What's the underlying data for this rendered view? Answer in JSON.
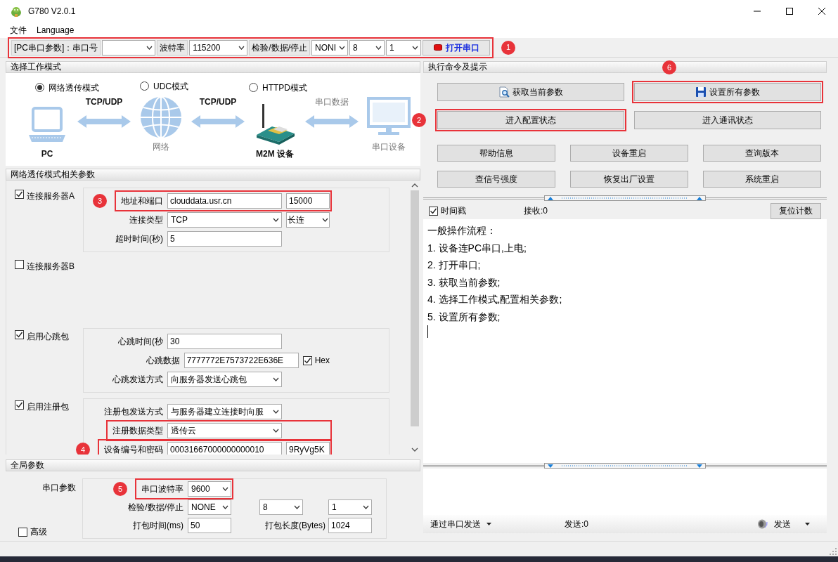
{
  "window": {
    "title": "G780 V2.0.1"
  },
  "menu": [
    {
      "label": "文件"
    },
    {
      "label": "Language"
    }
  ],
  "toolbar": {
    "highlighted": true,
    "callout": "1",
    "items": [
      {
        "kind": "label",
        "text": "[PC串口参数]：串口号"
      },
      {
        "kind": "select"
      },
      {
        "kind": "label",
        "text": "波特率"
      },
      {
        "kind": "select",
        "value": "115200"
      },
      {
        "kind": "label",
        "text": "检验/数据/停止"
      },
      {
        "kind": "select",
        "value": "NONI"
      },
      {
        "kind": "select",
        "value": "8"
      },
      {
        "kind": "select",
        "value": "1"
      },
      {
        "kind": "button",
        "text": "打开串口"
      }
    ]
  },
  "work_mode": {
    "title": "选择工作模式",
    "modes": [
      {
        "label": "网络透传模式",
        "selected": true
      },
      {
        "label": "UDC模式",
        "selected": false
      },
      {
        "label": "HTTPD模式",
        "selected": false
      }
    ],
    "diagram": {
      "nodes": [
        {
          "kind": "laptop",
          "label": "PC"
        },
        {
          "kind": "globe",
          "label": "网络"
        },
        {
          "kind": "device",
          "label": "M2M 设备"
        },
        {
          "kind": "monitor",
          "label": "串口设备"
        }
      ],
      "links": [
        {
          "kind": "network",
          "label": "TCP/UDP"
        },
        {
          "kind": "network",
          "label": "TCP/UDP"
        },
        {
          "kind": "serial",
          "label": "串口数据"
        }
      ]
    }
  },
  "net_params": {
    "title": "网络透传模式相关参数",
    "groups": [
      {
        "label": "连接服务器A",
        "checked": true,
        "rows": [
          {
            "label": "地址和端口",
            "highlighted": true,
            "callout": "3",
            "fields": [
              {
                "kind": "input",
                "value": "clouddata.usr.cn"
              },
              {
                "kind": "input",
                "value": "15000"
              }
            ]
          },
          {
            "label": "连接类型",
            "highlighted": false,
            "fields": [
              {
                "kind": "select",
                "value": "TCP"
              },
              {
                "kind": "select",
                "value": "长连"
              }
            ]
          },
          {
            "label": "超时时间(秒)",
            "highlighted": false,
            "fields": [
              {
                "kind": "input",
                "value": "5"
              }
            ]
          }
        ]
      },
      {
        "label": "连接服务器B",
        "checked": false
      },
      {
        "label": "启用心跳包",
        "checked": true,
        "rows": [
          {
            "label": "心跳时间(秒",
            "highlighted": false,
            "fields": [
              {
                "kind": "input",
                "value": "30"
              }
            ]
          },
          {
            "label": "心跳数据",
            "highlighted": false,
            "fields": [
              {
                "kind": "input",
                "value": "7777772E7573722E636E"
              },
              {
                "kind": "checkbox",
                "label": "Hex",
                "checked": true
              }
            ]
          },
          {
            "label": "心跳发送方式",
            "highlighted": false,
            "fields": [
              {
                "kind": "select",
                "value": "向服务器发送心跳包"
              }
            ]
          }
        ]
      },
      {
        "label": "启用注册包",
        "checked": true,
        "rows": [
          {
            "label": "注册包发送方式",
            "highlighted": false,
            "fields": [
              {
                "kind": "select",
                "value": "与服务器建立连接时向服"
              }
            ]
          },
          {
            "label": "注册数据类型",
            "highlighted": true,
            "fields": [
              {
                "kind": "select",
                "value": "透传云"
              }
            ]
          },
          {
            "label": "设备编号和密码",
            "highlighted": true,
            "callout": "4",
            "fields": [
              {
                "kind": "input",
                "value": "00031667000000000010"
              },
              {
                "kind": "input",
                "value": "9RyVg5K"
              }
            ]
          }
        ]
      }
    ]
  },
  "global_params": {
    "title": "全局参数",
    "label": "串口参数",
    "advanced": {
      "label": "高级",
      "checked": false
    },
    "rows": [
      {
        "label": "串口波特率",
        "highlighted": true,
        "callout": "5",
        "fields": [
          {
            "kind": "select",
            "value": "9600"
          }
        ]
      },
      {
        "label": "检验/数据/停止",
        "highlighted": false,
        "fields": [
          {
            "kind": "select",
            "value": "NONE"
          },
          {
            "kind": "select",
            "value": "8"
          },
          {
            "kind": "select",
            "value": "1"
          }
        ]
      },
      {
        "label": "打包时间(ms)",
        "highlighted": false,
        "fields": [
          {
            "kind": "input",
            "value": "50"
          },
          {
            "kind": "label",
            "text": "打包长度(Bytes)"
          },
          {
            "kind": "input",
            "value": "1024"
          }
        ]
      }
    ]
  },
  "commands": {
    "title": "执行命令及提示",
    "buttons": [
      {
        "label": "获取当前参数",
        "highlighted": false
      },
      {
        "label": "设置所有参数",
        "highlighted": true,
        "callout": "6"
      },
      {
        "label": "进入配置状态",
        "highlighted": true,
        "callout": "2"
      },
      {
        "label": "进入通讯状态",
        "highlighted": false
      }
    ],
    "tools": [
      {
        "label": "帮助信息"
      },
      {
        "label": "设备重启"
      },
      {
        "label": "查询版本"
      },
      {
        "label": "查信号强度"
      },
      {
        "label": "恢复出厂设置"
      },
      {
        "label": "系统重启"
      }
    ]
  },
  "log": {
    "timestamp": {
      "label": "时间戳",
      "checked": true
    },
    "received": "接收:0",
    "reset": "复位计数",
    "lines": [
      "一般操作流程：",
      "1. 设备连PC串口,上电;",
      "2. 打开串口;",
      "3. 获取当前参数;",
      "4. 选择工作模式,配置相关参数;",
      "5. 设置所有参数;"
    ]
  },
  "send": {
    "mode": "通过串口发送",
    "sent": "发送:0",
    "button": "发送"
  }
}
